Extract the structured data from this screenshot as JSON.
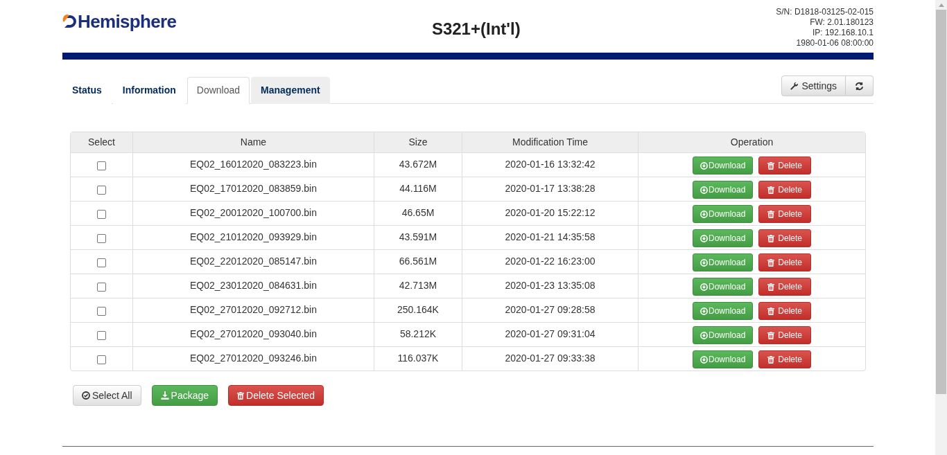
{
  "header": {
    "logo_text": "Hemisphere",
    "title": "S321+(Int'l)",
    "info": [
      "S/N: D1818-03125-02-015",
      "FW: 2.01.180123",
      "IP: 192.168.10.1",
      "1980-01-06 08:00:00"
    ]
  },
  "tabs": [
    {
      "label": "Status",
      "selected": false,
      "highlighted": false
    },
    {
      "label": "Information",
      "selected": false,
      "highlighted": false
    },
    {
      "label": "Download",
      "selected": true,
      "highlighted": false
    },
    {
      "label": "Management",
      "selected": false,
      "highlighted": true
    }
  ],
  "toolbar": {
    "settings_label": "Settings"
  },
  "table": {
    "columns": [
      "Select",
      "Name",
      "Size",
      "Modification Time",
      "Operation"
    ],
    "rows": [
      {
        "checked": false,
        "name": "EQ02_16012020_083223.bin",
        "size": "43.672M",
        "time": "2020-01-16 13:32:42",
        "download_label": "Download",
        "delete_label": "Delete"
      },
      {
        "checked": false,
        "name": "EQ02_17012020_083859.bin",
        "size": "44.116M",
        "time": "2020-01-17 13:38:28",
        "download_label": "Download",
        "delete_label": "Delete"
      },
      {
        "checked": false,
        "name": "EQ02_20012020_100700.bin",
        "size": "46.65M",
        "time": "2020-01-20 15:22:12",
        "download_label": "Download",
        "delete_label": "Delete"
      },
      {
        "checked": false,
        "name": "EQ02_21012020_093929.bin",
        "size": "43.591M",
        "time": "2020-01-21 14:35:58",
        "download_label": "Download",
        "delete_label": "Delete"
      },
      {
        "checked": false,
        "name": "EQ02_22012020_085147.bin",
        "size": "66.561M",
        "time": "2020-01-22 16:23:00",
        "download_label": "Download",
        "delete_label": "Delete"
      },
      {
        "checked": false,
        "name": "EQ02_23012020_084631.bin",
        "size": "42.713M",
        "time": "2020-01-23 13:35:08",
        "download_label": "Download",
        "delete_label": "Delete"
      },
      {
        "checked": false,
        "name": "EQ02_27012020_092712.bin",
        "size": "250.164K",
        "time": "2020-01-27 09:28:58",
        "download_label": "Download",
        "delete_label": "Delete"
      },
      {
        "checked": false,
        "name": "EQ02_27012020_093040.bin",
        "size": "58.212K",
        "time": "2020-01-27 09:31:04",
        "download_label": "Download",
        "delete_label": "Delete"
      },
      {
        "checked": false,
        "name": "EQ02_27012020_093246.bin",
        "size": "116.037K",
        "time": "2020-01-27 09:33:38",
        "download_label": "Download",
        "delete_label": "Delete"
      }
    ]
  },
  "actions": [
    {
      "kind": "select",
      "label": "Select All"
    },
    {
      "kind": "package",
      "label": "Package"
    },
    {
      "kind": "delete",
      "label": "Delete Selected"
    }
  ]
}
